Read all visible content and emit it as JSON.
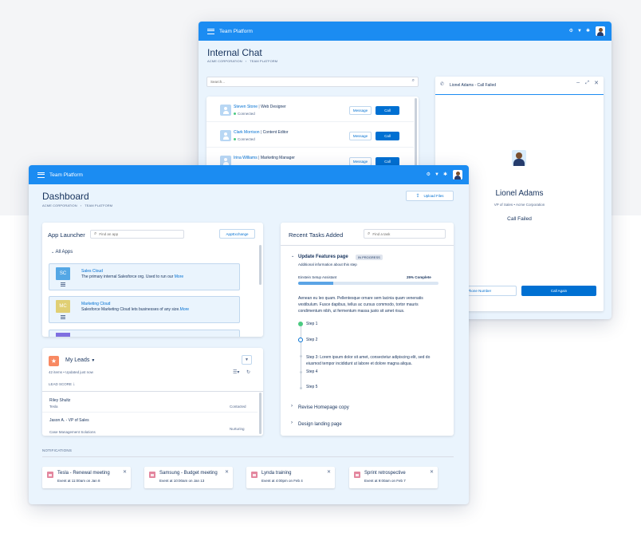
{
  "colors": {
    "topbar": "#1b8cf2",
    "brand_button": "#0070d2",
    "window_bg": "#eaf4fd",
    "status_connected": "#4bca81"
  },
  "chat_window": {
    "brand": "Team Platform",
    "title": "Internal Chat",
    "breadcrumb": [
      "ACME CORPORATION",
      "TEAM PLATFORM"
    ],
    "search_placeholder": "Search...",
    "contacts": [
      {
        "name": "Steven Stone",
        "role": "Web Designer",
        "status": "Connected",
        "message_label": "Message",
        "call_label": "Call"
      },
      {
        "name": "Clark Morrison",
        "role": "Content Editor",
        "status": "Connected",
        "message_label": "Message",
        "call_label": "Call"
      },
      {
        "name": "Irina Williams",
        "role": "Marketing Manager",
        "status": "",
        "message_label": "Message",
        "call_label": "Call"
      }
    ],
    "call_panel": {
      "header": "Lionel Adams - Call Failed",
      "name": "Lionel Adams",
      "subtitle": "VP of Sales • Acme Corporation",
      "status": "Call Failed",
      "phone_button": "Phone Number",
      "call_again": "Call Again"
    }
  },
  "dashboard": {
    "brand": "Team Platform",
    "title": "Dashboard",
    "breadcrumb": [
      "ACME CORPORATION",
      "TEAM PLATFORM"
    ],
    "upload_label": "Upload Files",
    "app_launcher": {
      "title": "App Launcher",
      "search_placeholder": "Find an app",
      "appexchange_label": "AppExchange",
      "section": "All Apps",
      "apps": [
        {
          "initials": "SC",
          "name": "Sales Cloud",
          "desc": "The primary internal Salesforce org. Used to run our",
          "more": "More",
          "color": "#54a7e5"
        },
        {
          "initials": "MC",
          "name": "Marketing Cloud",
          "desc": "Salesforce Marketing Cloud lets businesses of any size.",
          "more": "More",
          "color": "#e0cf74"
        }
      ]
    },
    "leads": {
      "title": "My Leads",
      "meta": "42 items • Updated just now",
      "column": "LEAD SCORE",
      "rows": [
        {
          "name": "Riley Shultz",
          "company": "Tesla",
          "status": "Contacted"
        },
        {
          "name": "Jason A. - VP of Sales",
          "company": "Case Management Solutions",
          "status": "Nurturing"
        }
      ]
    },
    "tasks": {
      "title": "Recent Tasks Added",
      "search_placeholder": "Find a task",
      "active_task": {
        "name": "Update Features page",
        "badge": "IN PROGRESS",
        "subtitle": "Additional information about this step",
        "progress_label": "Einstein Setup Assistant",
        "progress_text": "25% Complete",
        "progress": 0.25,
        "body": [
          "Aenean eu leo quam. Pellentesque ornare sem lacinia quam venenatis",
          "vestibulum. Fusce dapibus, tellus ac cursus commodo, tortor mauris",
          "condimentum nibh, ut fermentum massa justo sit amet risus."
        ],
        "steps": [
          "Step 1",
          "Step 2",
          "Step 3: Lorem ipsum dolor sit amet, consectetur adipiscing elit, sed do",
          "Step 4",
          "Step 5"
        ],
        "step3_line2": "eiusmod tempor incididunt ut labore et dolore magna aliqua."
      },
      "other_tasks": [
        "Revise Homepage copy",
        "Design landing page"
      ]
    },
    "notifications": {
      "heading": "NOTIFICATIONS",
      "items": [
        {
          "title": "Tesla - Renewal meeting",
          "sub": "Event at 11:00am on Jan 8"
        },
        {
          "title": "Samsung - Budget meeting",
          "sub": "Event at 10:00am on Jan 13"
        },
        {
          "title": "Lynda training",
          "sub": "Event at 4:00pm on Feb 4"
        },
        {
          "title": "Sprint retrospective",
          "sub": "Event at 9:00am on Feb 7"
        }
      ]
    }
  }
}
